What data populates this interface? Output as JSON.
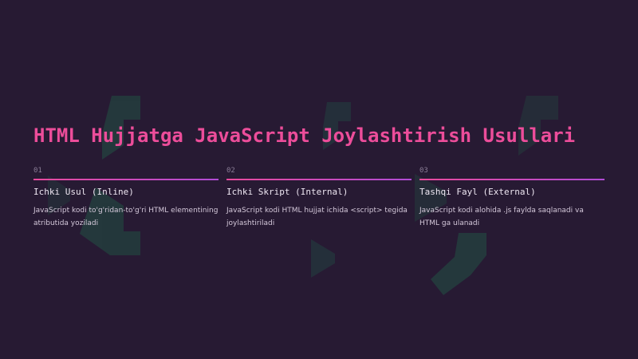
{
  "slide": {
    "title": "HTML Hujjatga JavaScript Joylashtirish Usullari",
    "cards": [
      {
        "number": "01",
        "title": "Ichki Usul (Inline)",
        "description": "JavaScript kodi to'g'ridan-to'g'ri HTML elementining atributida yoziladi"
      },
      {
        "number": "02",
        "title": "Ichki Skript (Internal)",
        "description": "JavaScript kodi HTML hujjat ichida <script> tegida joylashtiriladi"
      },
      {
        "number": "03",
        "title": "Tashqi Fayl (External)",
        "description": "JavaScript kodi alohida .js faylda saqlanadi va HTML ga ulanadi"
      }
    ]
  },
  "colors": {
    "background": "#271a33",
    "accent_pink": "#ec4d9a",
    "accent_purple": "#b14bd6",
    "decor_teal": "#1f4a47"
  },
  "icons": [
    "code-bracket-decor-icon"
  ]
}
